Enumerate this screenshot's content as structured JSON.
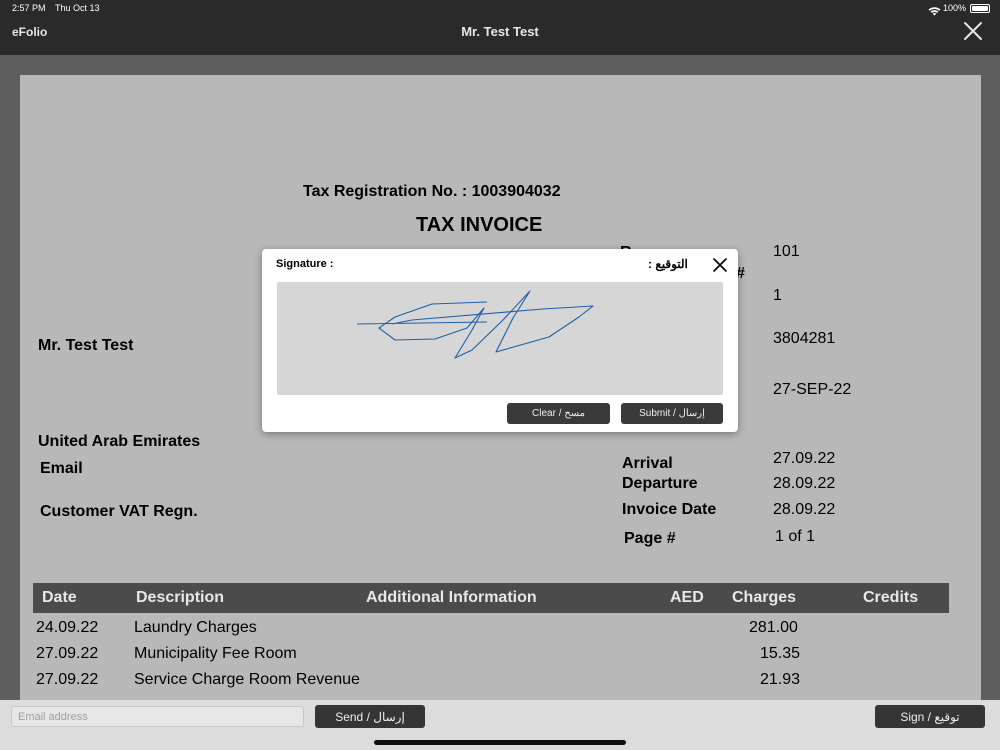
{
  "status": {
    "time": "2:57 PM",
    "date": "Thu Oct 13",
    "battery": "100%"
  },
  "header": {
    "app_name": "eFolio",
    "title": "Mr. Test Test"
  },
  "invoice": {
    "tax_registration": "Tax Registration No. : 1003904032",
    "heading": "TAX INVOICE",
    "guest_name": "Mr. Test Test",
    "country": "United Arab Emirates",
    "email_label": "Email",
    "vat_label": "Customer VAT Regn.",
    "partial_label_1": "R",
    "partial_label_2": "#",
    "fields": [
      {
        "label": "Arrival",
        "value": "27.09.22"
      },
      {
        "label": "Departure",
        "value": "28.09.22"
      },
      {
        "label": "Invoice Date",
        "value": "28.09.22"
      },
      {
        "label": "Page #",
        "value": "1 of 1"
      }
    ],
    "top_values": [
      "101",
      "1",
      "3804281",
      "27-SEP-22"
    ],
    "table": {
      "columns": [
        "Date",
        "Description",
        "Additional Information",
        "AED",
        "Charges",
        "Credits"
      ],
      "rows": [
        {
          "date": "24.09.22",
          "description": "Laundry Charges",
          "charges": "281.00"
        },
        {
          "date": "27.09.22",
          "description": "Municipality Fee Room",
          "charges": "15.35"
        },
        {
          "date": "27.09.22",
          "description": "Service Charge Room Revenue",
          "charges": "21.93"
        }
      ]
    }
  },
  "signature_dialog": {
    "label": "Signature :",
    "label_ar": "التوقيع :",
    "clear_label": "Clear / مسح",
    "submit_label": "Submit / إرسال"
  },
  "bottom": {
    "email_placeholder": "Email address",
    "send_label": "Send / إرسال",
    "sign_label": "Sign / توقيع"
  },
  "colors": {
    "topbar": "#2a2a2a",
    "document": "#b8b8b8",
    "table_header": "#4b4b4b",
    "signature_ink": "#1f5fa8"
  }
}
